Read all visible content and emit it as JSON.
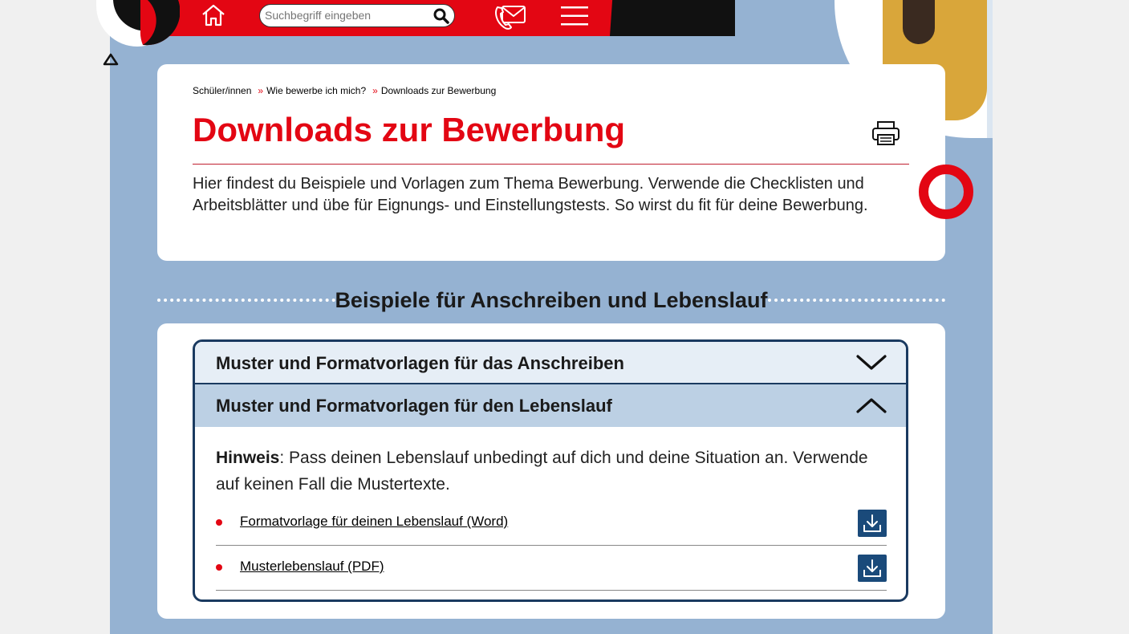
{
  "header": {
    "search_placeholder": "Suchbegriff eingeben"
  },
  "breadcrumb": {
    "items": [
      "Schüler/innen",
      "Wie bewerbe ich mich?",
      "Downloads zur Bewerbung"
    ],
    "separator": "»"
  },
  "page": {
    "title": "Downloads zur Bewerbung",
    "intro": "Hier findest du Beispiele und Vorlagen zum Thema Bewerbung. Verwende die Checklisten und Arbeitsblätter und übe für Eignungs- und Einstellungstests. So wirst du fit für deine Bewerbung."
  },
  "section": {
    "heading": "Beispiele für Anschreiben und Lebenslauf",
    "accordion": [
      {
        "label": "Muster und Formatvorlagen für das Anschreiben",
        "expanded": false
      },
      {
        "label": "Muster und Formatvorlagen für den Lebenslauf",
        "expanded": true
      }
    ],
    "note_label": "Hinweis",
    "note_text": ": Pass deinen Lebenslauf unbedingt auf dich und deine Situation an. Verwende auf keinen Fall die Mustertexte.",
    "downloads": [
      {
        "label": "Formatvorlage für deinen Lebenslauf (Word)"
      },
      {
        "label": "Musterlebenslauf (PDF)"
      }
    ]
  },
  "colors": {
    "brand_red": "#e30613",
    "navy": "#1a3a60",
    "background_blue": "#95b2d2"
  }
}
